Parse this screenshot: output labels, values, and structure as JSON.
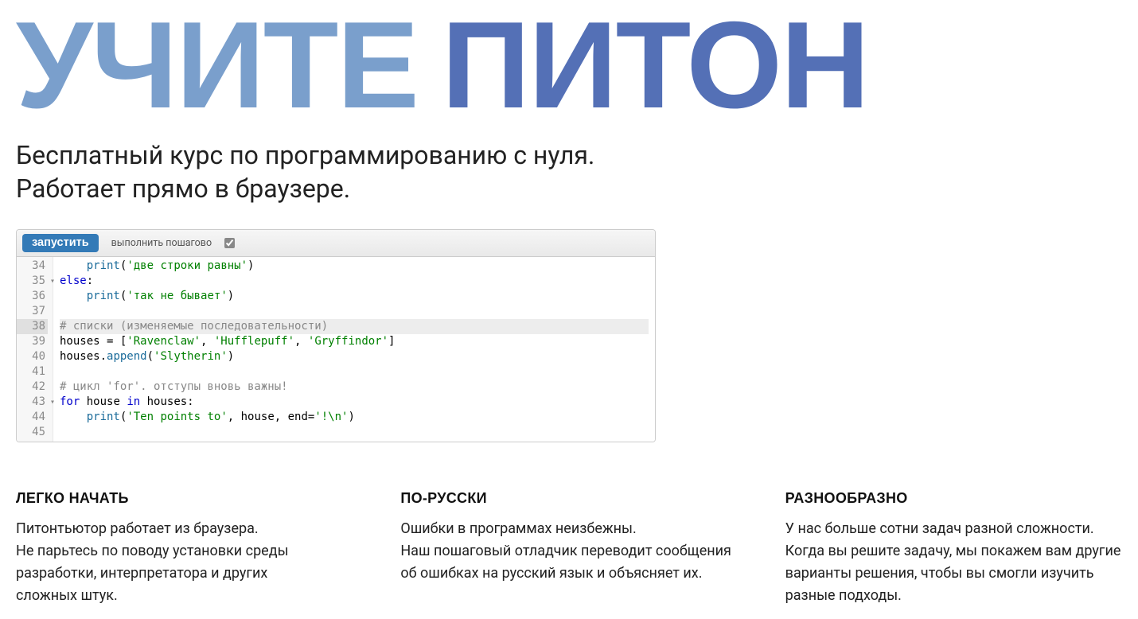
{
  "hero": {
    "word1": "УЧИТЕ",
    "word2": "ПИТОН",
    "subtitle_line1": "Бесплатный курс по программированию с нуля.",
    "subtitle_line2": "Работает прямо в браузере."
  },
  "editor": {
    "run_label": "запустить",
    "step_label": "выполнить пошагово",
    "step_checked": true,
    "lines": [
      {
        "num": 34,
        "fold": false,
        "hi": false,
        "html": "    <span class='tok-fn'>print</span>(<span class='tok-str'>'две строки равны'</span>)"
      },
      {
        "num": 35,
        "fold": true,
        "hi": false,
        "html": "<span class='tok-kw'>else</span>:"
      },
      {
        "num": 36,
        "fold": false,
        "hi": false,
        "html": "    <span class='tok-fn'>print</span>(<span class='tok-str'>'так не бывает'</span>)"
      },
      {
        "num": 37,
        "fold": false,
        "hi": false,
        "html": ""
      },
      {
        "num": 38,
        "fold": false,
        "hi": true,
        "html": "<span class='tok-cmt'># списки (изменяемые последовательности)</span>"
      },
      {
        "num": 39,
        "fold": false,
        "hi": false,
        "html": "houses = [<span class='tok-str'>'Ravenclaw'</span>, <span class='tok-str'>'Hufflepuff'</span>, <span class='tok-str'>'Gryffindor'</span>]"
      },
      {
        "num": 40,
        "fold": false,
        "hi": false,
        "html": "houses.<span class='tok-fn'>append</span>(<span class='tok-str'>'Slytherin'</span>)"
      },
      {
        "num": 41,
        "fold": false,
        "hi": false,
        "html": ""
      },
      {
        "num": 42,
        "fold": false,
        "hi": false,
        "html": "<span class='tok-cmt'># цикл 'for'. отступы вновь важны!</span>"
      },
      {
        "num": 43,
        "fold": true,
        "hi": false,
        "html": "<span class='tok-kw'>for</span> house <span class='tok-kw'>in</span> houses:"
      },
      {
        "num": 44,
        "fold": false,
        "hi": false,
        "html": "    <span class='tok-fn'>print</span>(<span class='tok-str'>'Ten points to'</span>, house, end=<span class='tok-str'>'!\\n'</span>)"
      },
      {
        "num": 45,
        "fold": false,
        "hi": false,
        "html": ""
      }
    ]
  },
  "features": [
    {
      "title": "ЛЕГКО НАЧАТЬ",
      "body": "Питонтьютор работает из браузера.\nНе парьтесь по поводу установки среды разработки, интерпретатора и других сложных штук."
    },
    {
      "title": "ПО-РУССКИ",
      "body": "Ошибки в программах неизбежны.\nНаш пошаговый отладчик переводит сообщения об ошибках на русский язык и объясняет их."
    },
    {
      "title": "РАЗНООБРАЗНО",
      "body": "У нас больше сотни задач разной сложности. Когда вы решите задачу, мы покажем вам другие варианты решения, чтобы вы смогли изучить разные подходы."
    }
  ]
}
